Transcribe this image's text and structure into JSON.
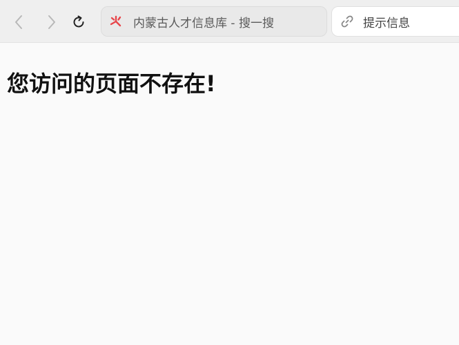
{
  "toolbar": {
    "tab_title": "内蒙古人才信息库 - 搜一搜",
    "address_placeholder": "提示信息",
    "icons": {
      "back": "chevron-left-icon",
      "forward": "chevron-right-icon",
      "reload": "reload-icon",
      "favicon": "site-favicon-icon",
      "link": "link-icon"
    },
    "colors": {
      "favicon": "#e8454a",
      "disabled_nav": "#b8b8b8"
    }
  },
  "main": {
    "heading": "您访问的页面不存在!"
  }
}
